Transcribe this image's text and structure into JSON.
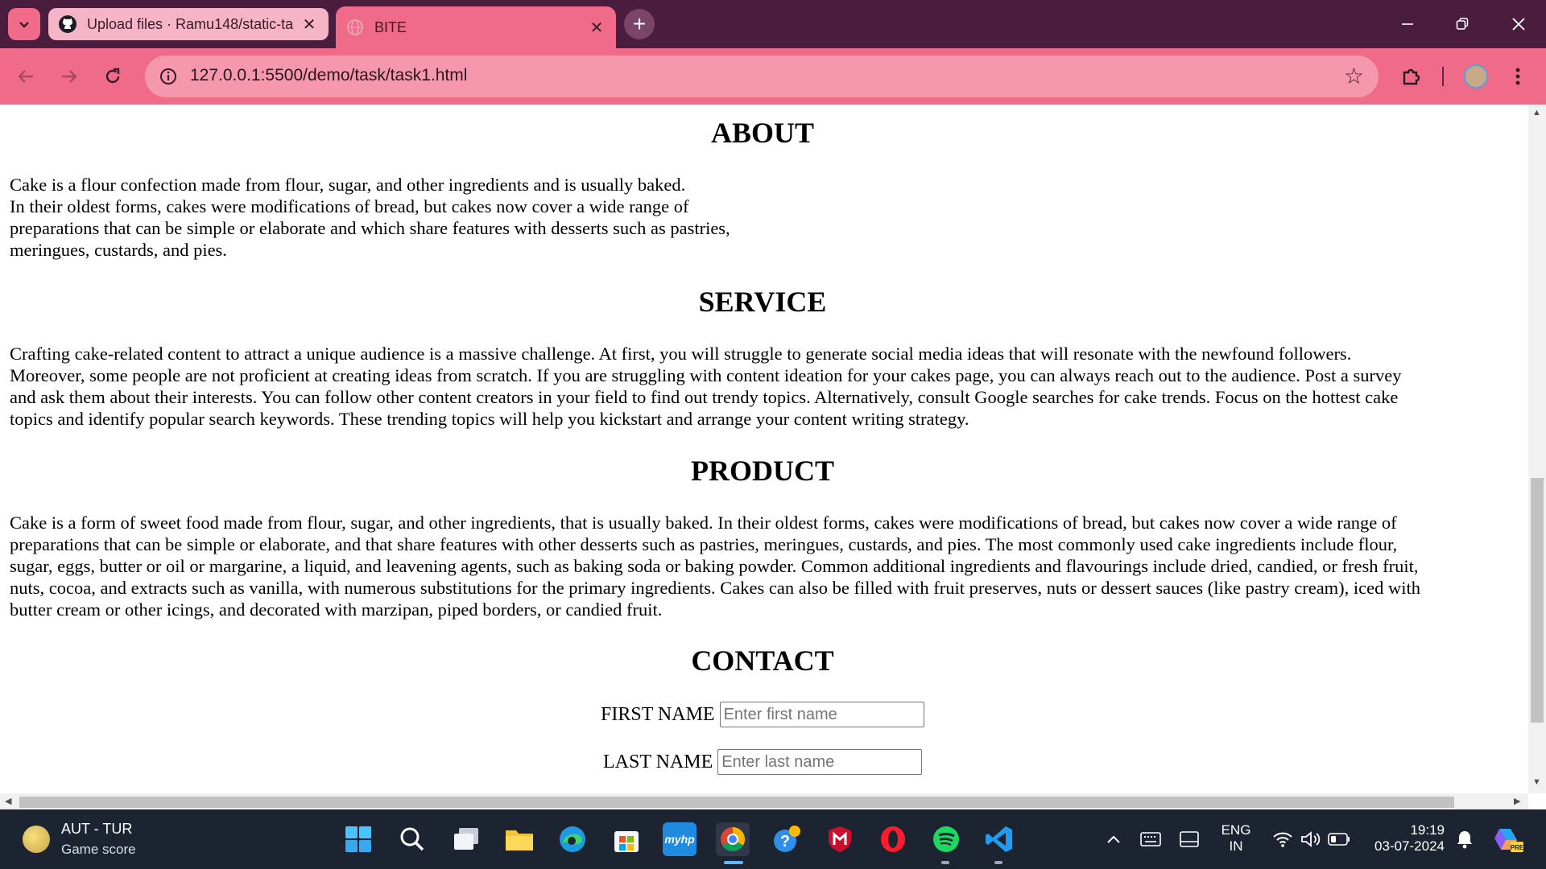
{
  "browser": {
    "tabs": [
      {
        "title": "Upload files · Ramu148/static-ta",
        "icon": "github-icon",
        "active": false
      },
      {
        "title": "BITE",
        "icon": "globe-icon",
        "active": true
      }
    ],
    "address_bar": {
      "url": "127.0.0.1:5500/demo/task/task1.html"
    },
    "colors": {
      "frame": "#4a1d3f",
      "toolbar": "#f06b8a",
      "omnibox": "#f598ae"
    }
  },
  "page": {
    "sections": [
      {
        "heading": "ABOUT",
        "lines": [
          "Cake is a flour confection made from flour, sugar, and other ingredients and is usually baked.",
          "In their oldest forms, cakes were modifications of bread, but cakes now cover a wide range of",
          "preparations that can be simple or elaborate and which share features with desserts such as pastries,",
          "meringues, custards, and pies."
        ]
      },
      {
        "heading": "SERVICE",
        "lines": [
          "Crafting cake-related content to attract a unique audience is a massive challenge. At first, you will struggle to generate social media ideas that will resonate with the newfound followers.",
          "Moreover, some people are not proficient at creating ideas from scratch. If you are struggling with content ideation for your cakes page, you can always reach out to the audience. Post a survey",
          "and ask them about their interests. You can follow other content creators in your field to find out trendy topics. Alternatively, consult Google searches for cake trends. Focus on the hottest cake",
          "topics and identify popular search keywords. These trending topics will help you kickstart and arrange your content writing strategy."
        ]
      },
      {
        "heading": "PRODUCT",
        "lines": [
          "Cake is a form of sweet food made from flour, sugar, and other ingredients, that is usually baked. In their oldest forms, cakes were modifications of bread, but cakes now cover a wide range of",
          "preparations that can be simple or elaborate, and that share features with other desserts such as pastries, meringues, custards, and pies. The most commonly used cake ingredients include flour,",
          "sugar, eggs, butter or oil or margarine, a liquid, and leavening agents, such as baking soda or baking powder. Common additional ingredients and flavourings include dried, candied, or fresh fruit,",
          "nuts, cocoa, and extracts such as vanilla, with numerous substitutions for the primary ingredients. Cakes can also be filled with fruit preserves, nuts or dessert sauces (like pastry cream), iced with",
          "butter cream or other icings, and decorated with marzipan, piped borders, or candied fruit."
        ]
      },
      {
        "heading": "CONTACT",
        "fields": [
          {
            "label": "FIRST NAME",
            "placeholder": "Enter first name",
            "value": ""
          },
          {
            "label": "LAST NAME",
            "placeholder": "Enter last name",
            "value": ""
          }
        ]
      }
    ]
  },
  "taskbar": {
    "widget": {
      "title": "AUT - TUR",
      "subtitle": "Game score"
    },
    "apps": [
      "windows-start-icon",
      "search-icon",
      "task-view-icon",
      "file-explorer-icon",
      "edge-icon",
      "microsoft-store-icon",
      "myhp-icon",
      "chrome-icon",
      "help-icon",
      "mcafee-icon",
      "opera-icon",
      "spotify-icon",
      "vscode-icon"
    ],
    "myhp_label": "myhp",
    "language": {
      "line1": "ENG",
      "line2": "IN"
    },
    "clock": {
      "time": "19:19",
      "date": "03-07-2024"
    },
    "copilot_badge": "PRE"
  }
}
